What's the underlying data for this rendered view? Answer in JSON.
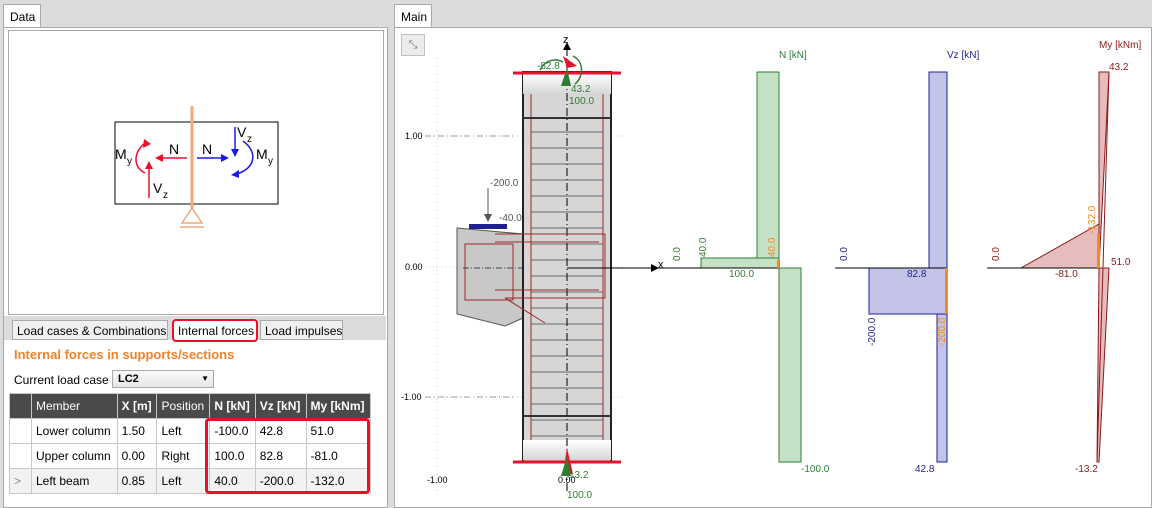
{
  "data_tab": {
    "label": "Data"
  },
  "main_tab": {
    "label": "Main"
  },
  "schematic": {
    "m_left": "M",
    "m_left_sub": "y",
    "n_left": "N",
    "v_left": "V",
    "v_left_sub": "z",
    "n_right": "N",
    "v_right": "V",
    "v_right_sub": "z",
    "m_right": "M",
    "m_right_sub": "y"
  },
  "subtabs": [
    "Load cases & Combinations",
    "Internal forces",
    "Load impulses"
  ],
  "section_title": "Internal forces in supports/sections",
  "load_case": {
    "label": "Current load case",
    "value": "LC2"
  },
  "table": {
    "headers": [
      "Member",
      "X [m]",
      "Position",
      "N [kN]",
      "Vz [kN]",
      "My [kNm]"
    ],
    "rows": [
      {
        "marker": "",
        "cells": [
          "Lower column",
          "1.50",
          "Left",
          "-100.0",
          "42.8",
          "51.0"
        ]
      },
      {
        "marker": "",
        "cells": [
          "Upper column",
          "0.00",
          "Right",
          "100.0",
          "82.8",
          "-81.0"
        ]
      },
      {
        "marker": ">",
        "cells": [
          "Left beam",
          "0.85",
          "Left",
          "40.0",
          "-200.0",
          "-132.0"
        ]
      }
    ]
  },
  "canvas": {
    "axis_z": "z",
    "axis_x": "x",
    "ticks_y": [
      "1.00",
      "0.00",
      "-1.00"
    ],
    "ticks_x": [
      "-1.00",
      "0.00"
    ],
    "structure_labels": {
      "top_n": "-82.8",
      "top_my": "43.2",
      "top_vz": "100.0",
      "load_main": "-200.0",
      "load_sec": "-40.0",
      "bot_my": "13.2",
      "bot_vz": "100.0"
    },
    "colors": {
      "n": "#2e7d32",
      "vz": "#1f1f8f",
      "my": "#8b1a1a",
      "highlight": "#e8102a",
      "orange": "#f28a1c"
    }
  },
  "diagrams": {
    "n": {
      "title": "N [kN]",
      "zero": "0.0",
      "side_val": "40.0",
      "orange_val": "40.0",
      "mid_val": "100.0",
      "bottom_val": "-100.0"
    },
    "vz": {
      "title": "Vz [kN]",
      "zero": "0.0",
      "mid_val": "82.8",
      "side_val": "-200.0",
      "orange_val": "-200.0",
      "bottom_val": "42.8"
    },
    "my": {
      "title": "My [kNm]",
      "top_val": "43.2",
      "zero": "0.0",
      "orange_val": "-132.0",
      "right_val": "51.0",
      "mid_val": "-81.0",
      "bottom_val": "-13.2"
    }
  }
}
